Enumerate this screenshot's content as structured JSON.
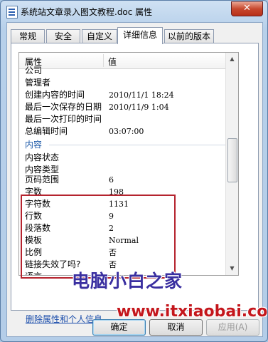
{
  "window": {
    "title": "系统站文章录入图文教程.doc 属性",
    "close_label": "✕"
  },
  "tabs": [
    {
      "label": "常规"
    },
    {
      "label": "安全"
    },
    {
      "label": "自定义"
    },
    {
      "label": "详细信息"
    },
    {
      "label": "以前的版本"
    }
  ],
  "columns": {
    "property": "属性",
    "value": "值"
  },
  "rows_top": [
    {
      "k": "公司",
      "v": ""
    },
    {
      "k": "管理者",
      "v": ""
    },
    {
      "k": "创建内容的时间",
      "v": "2010/11/1 18:24"
    },
    {
      "k": "最后一次保存的日期",
      "v": "2010/11/9 1:04"
    },
    {
      "k": "最后一次打印的时间",
      "v": ""
    },
    {
      "k": "总编辑时间",
      "v": "03:07:00"
    }
  ],
  "group_label": "内容",
  "rows_content": [
    {
      "k": "内容状态",
      "v": ""
    },
    {
      "k": "内容类型",
      "v": ""
    },
    {
      "k": "页码范围",
      "v": "6"
    },
    {
      "k": "字数",
      "v": "198"
    },
    {
      "k": "字符数",
      "v": "1131"
    },
    {
      "k": "行数",
      "v": "9"
    },
    {
      "k": "段落数",
      "v": "2"
    },
    {
      "k": "模板",
      "v": "Normal"
    },
    {
      "k": "比例",
      "v": "否"
    },
    {
      "k": "链接失效了吗?",
      "v": "否"
    },
    {
      "k": "语言",
      "v": ""
    }
  ],
  "remove_link": "删除属性和个人信息",
  "buttons": {
    "ok": "确定",
    "cancel": "取消",
    "apply": "应用(A)"
  },
  "watermark": {
    "line1": "电脑小白之家",
    "line2": "www.itxiaobai.com"
  },
  "colors": {
    "highlight_box": "#b5232e",
    "link": "#1a4dab"
  }
}
